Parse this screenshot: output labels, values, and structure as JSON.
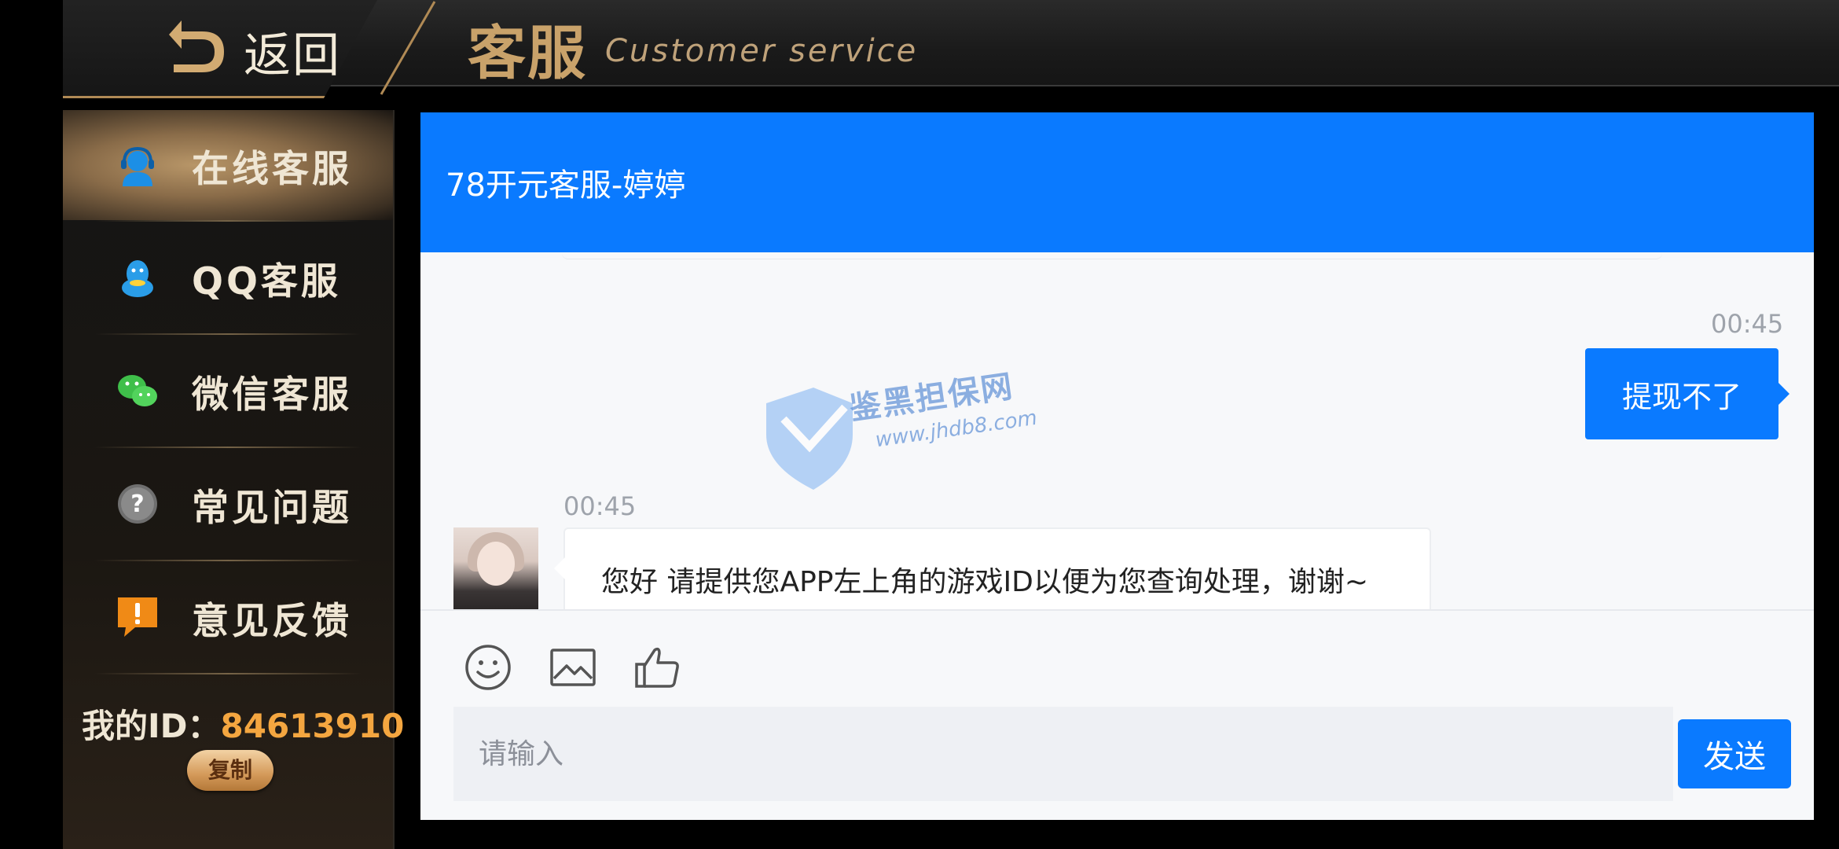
{
  "topbar": {
    "back_label": "返回",
    "title_cn": "客服",
    "title_en": "Customer service"
  },
  "sidebar": {
    "items": [
      {
        "label": "在线客服",
        "icon": "headset-icon",
        "active": true
      },
      {
        "label": "QQ客服",
        "icon": "qq-penguin-icon",
        "active": false
      },
      {
        "label": "微信客服",
        "icon": "wechat-icon",
        "active": false
      },
      {
        "label": "常见问题",
        "icon": "question-icon",
        "active": false
      },
      {
        "label": "意见反馈",
        "icon": "feedback-icon",
        "active": false
      }
    ],
    "my_id_label": "我的ID：",
    "my_id_value": "84613910",
    "copy_label": "复制"
  },
  "chat": {
    "title": "78开元客服-婷婷",
    "messages": [
      {
        "side": "right",
        "time": "00:45",
        "text": "提现不了"
      },
      {
        "side": "left",
        "time": "00:45",
        "text": "您好 请提供您APP左上角的游戏ID以便为您查询处理，谢谢~"
      }
    ],
    "watermark_text": "鉴黑担保网",
    "watermark_url": "www.jhdb8.com",
    "tools": [
      "emoji-icon",
      "image-icon",
      "thumbs-up-icon"
    ],
    "input_placeholder": "请输入",
    "send_label": "发送"
  },
  "colors": {
    "accent": "#0a7aff",
    "gold": "#c9a26a",
    "id_orange": "#f4a640"
  }
}
